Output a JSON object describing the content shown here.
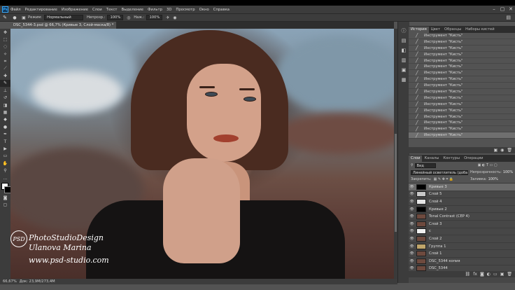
{
  "menu": [
    "Файл",
    "Редактирование",
    "Изображение",
    "Слои",
    "Текст",
    "Выделение",
    "Фильтр",
    "3D",
    "Просмотр",
    "Окно",
    "Справка"
  ],
  "options": {
    "mode_label": "Режим:",
    "mode_value": "Нормальный",
    "opacity_label": "Непрозр.:",
    "opacity_value": "100%",
    "pressure_label": "Наж.:",
    "pressure_value": "100%"
  },
  "document_tab": "DSC_5344-3.psd @ 66,7% (Кривые 3, Слой-маска/8) *",
  "status": {
    "zoom": "66,67%",
    "doc": "Док: 23,9M/273,4M"
  },
  "history": {
    "tabs": [
      "История",
      "Цвет",
      "Образцы",
      "Наборы кистей"
    ],
    "items": [
      "Инструмент \"Кисть\"",
      "Инструмент \"Кисть\"",
      "Инструмент \"Кисть\"",
      "Инструмент \"Кисть\"",
      "Инструмент \"Кисть\"",
      "Инструмент \"Кисть\"",
      "Инструмент \"Кисть\"",
      "Инструмент \"Кисть\"",
      "Инструмент \"Кисть\"",
      "Инструмент \"Кисть\"",
      "Инструмент \"Кисть\"",
      "Инструмент \"Кисть\"",
      "Инструмент \"Кисть\"",
      "Инструмент \"Кисть\"",
      "Инструмент \"Кисть\"",
      "Инструмент \"Кисть\"",
      "Инструмент \"Кисть\""
    ]
  },
  "layers": {
    "tabs": [
      "Слои",
      "Каналы",
      "Контуры",
      "Операции"
    ],
    "filter_label": "Вид",
    "blend_mode": "Линейный осветлитель (добавить)",
    "opacity_label": "Непрозрачность:",
    "opacity_value": "100%",
    "lock_label": "Закрепить:",
    "fill_label": "Заливка:",
    "fill_value": "100%",
    "items": [
      {
        "name": "Кривые 3",
        "thumb": "#000000"
      },
      {
        "name": "Слой 5",
        "thumb": "#c8c8c8"
      },
      {
        "name": "Слой 4",
        "thumb": "#e6e6e6"
      },
      {
        "name": "Кривые 2",
        "thumb": "#000000"
      },
      {
        "name": "Tonal Contrast (CEP 4)",
        "thumb": "#6e4a3e"
      },
      {
        "name": "Слой 3",
        "thumb": "#6e4a3e"
      },
      {
        "name": "с",
        "thumb": "#f0f0f0"
      },
      {
        "name": "Слой 2",
        "thumb": "#6e4a3e"
      },
      {
        "name": "Группа 1",
        "thumb": "#bfa56a"
      },
      {
        "name": "Слой 1",
        "thumb": "#6e4a3e"
      },
      {
        "name": "DSC_5344 копия",
        "thumb": "#6e4a3e"
      },
      {
        "name": "DSC_5344",
        "thumb": "#6e4a3e"
      }
    ]
  },
  "watermark": {
    "logo": "PSD",
    "line1": "PhotoStudioDesign",
    "line2": "Ulanova Marina",
    "line3": "www.psd-studio.com"
  }
}
